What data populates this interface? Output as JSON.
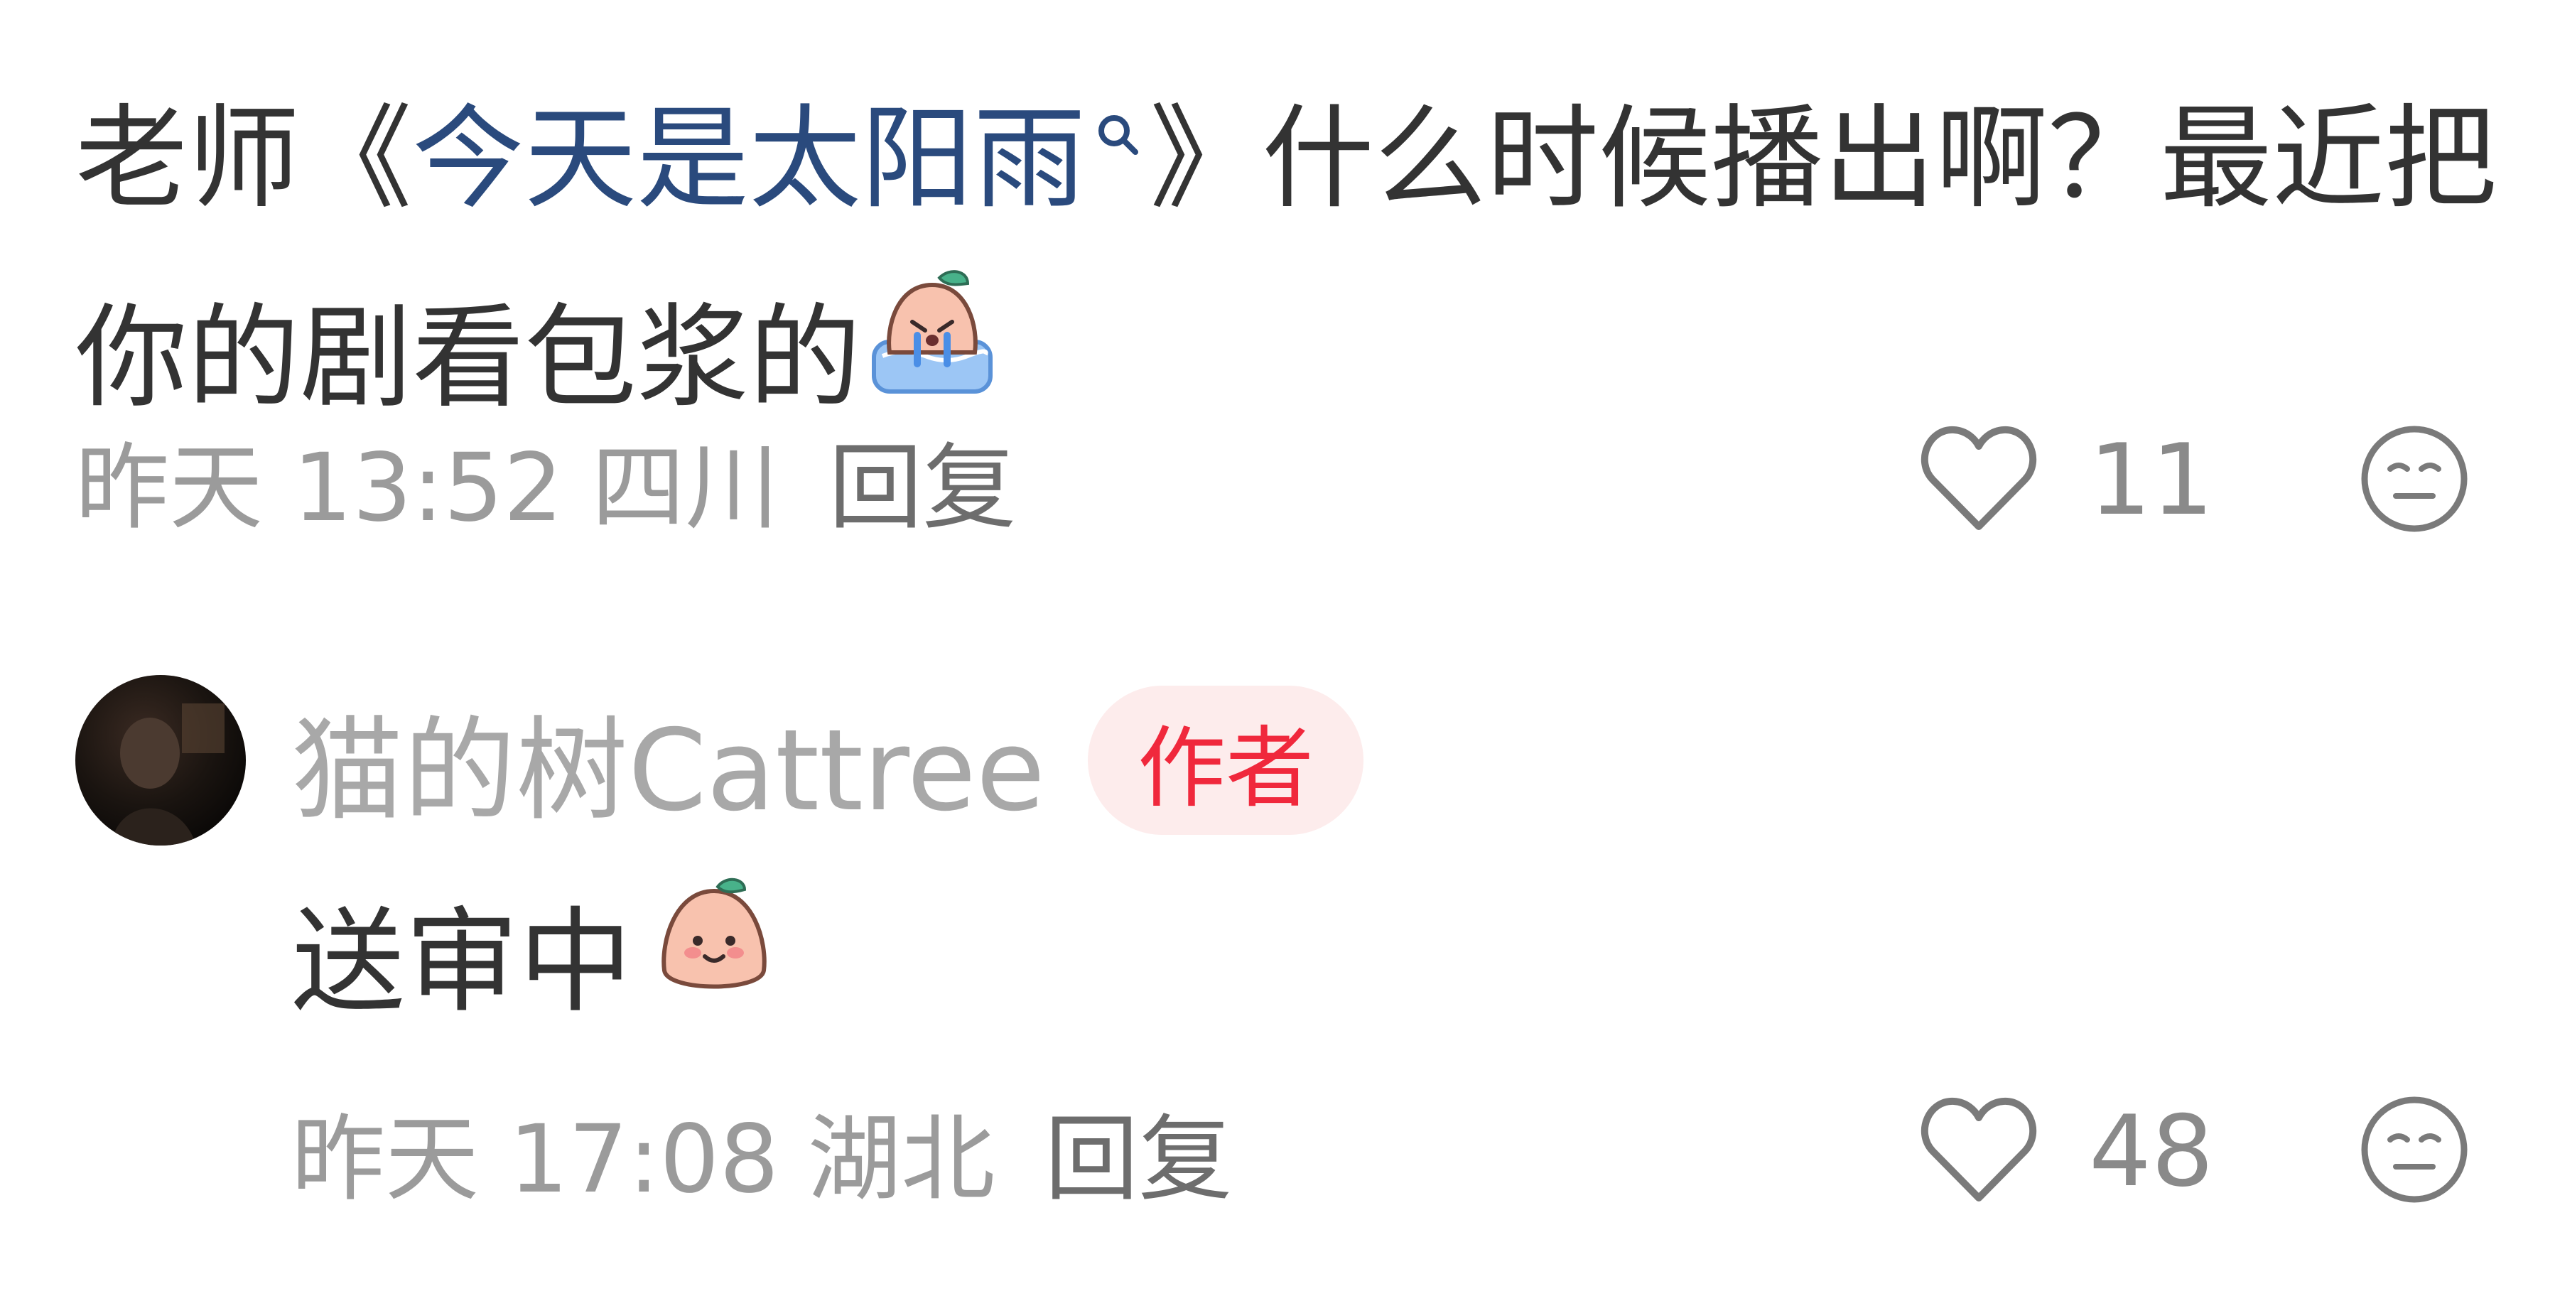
{
  "comment": {
    "text_prefix": "老师《",
    "title_link": "今天是太阳雨",
    "text_suffix": "》什么时候播出啊？最近把你的剧看包浆的",
    "sticker": "crying-peach-sticker",
    "time": "昨天 13:52",
    "region": "四川",
    "reply_label": "回复",
    "likes": "11"
  },
  "reply": {
    "author": "猫的树Cattree",
    "badge": "作者",
    "text": "送审中",
    "sticker": "smiling-peach-sticker",
    "time": "昨天 17:08",
    "region": "湖北",
    "reply_label": "回复",
    "likes": "48"
  },
  "colors": {
    "link": "#2a4a7d",
    "badge_text": "#f0283c",
    "badge_bg": "#fdecec",
    "meta": "#9b9b9b"
  },
  "icons": [
    "search-icon",
    "heart-icon",
    "emoji-neutral-icon"
  ]
}
